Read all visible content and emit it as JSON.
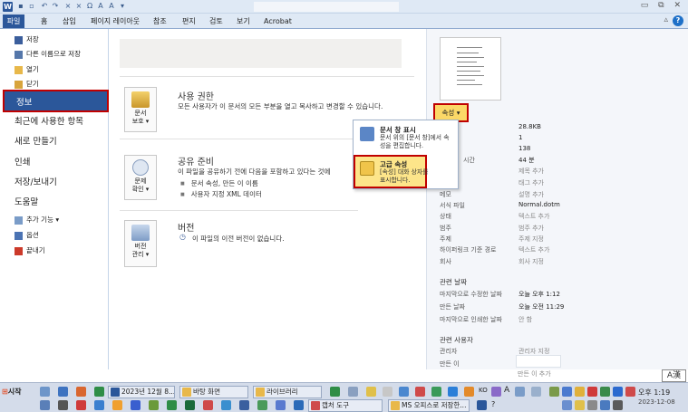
{
  "tabs": {
    "file": "파일",
    "home": "홈",
    "insert": "삽입",
    "page_layout": "페이지 레이아웃",
    "references": "참조",
    "mailings": "편지",
    "review": "검토",
    "view": "보기",
    "acrobat": "Acrobat"
  },
  "nav": {
    "save": "저장",
    "save_as": "다른 이름으로 저장",
    "open": "열기",
    "close": "닫기",
    "info": "정보",
    "recent": "최근에 사용한 항목",
    "new": "새로 만들기",
    "print": "인쇄",
    "save_send": "저장/보내기",
    "help": "도움말",
    "addins": "추가 기능 ▾",
    "options": "옵션",
    "exit": "끝내기"
  },
  "permissions": {
    "button_line1": "문서",
    "button_line2": "보호 ▾",
    "title": "사용 권한",
    "desc": "모든 사용자가 이 문서의 모든 부분을 열고 복사하고 변경할 수 있습니다."
  },
  "share": {
    "button_line1": "문제",
    "button_line2": "확인 ▾",
    "title": "공유 준비",
    "desc": "이 파일을 공유하기 전에 다음을 포함하고 있다는 것에",
    "bullet1": "문서 속성, 만든 이 이름",
    "bullet2": "사용자 지정 XML 데이터"
  },
  "versions": {
    "button_line1": "버전",
    "button_line2": "관리 ▾",
    "title": "버전",
    "desc": "이 파일의 이전 버전이 없습니다."
  },
  "properties_button": "속성 ▾",
  "dropdown": {
    "item1_title": "문서 창 표시",
    "item1_desc": "문서 위의 [문서 창]에서 속성을 편집합니다.",
    "item2_title": "고급 속성",
    "item2_desc": "[속성] 대화 상자를 표시합니다."
  },
  "properties": {
    "size_value": "28.8KB",
    "pages_value": "1",
    "words_value": "138",
    "time_label": "시간",
    "time_value": "44 분",
    "title_value": "제목 추가",
    "tags_value": "태그 추가",
    "comments_label": "메모",
    "comments_value": "설명 추가",
    "template_label": "서식 파일",
    "template_value": "Normal.dotm",
    "status_label": "상태",
    "status_value": "텍스트 추가",
    "category_label": "범주",
    "category_value": "범주 추가",
    "subject_label": "주제",
    "subject_value": "주제 지정",
    "hyperlink_label": "하이퍼링크 기준 경로",
    "hyperlink_value": "텍스트 추가",
    "company_label": "회사",
    "company_value": "회사 지정"
  },
  "related_dates": {
    "heading": "관련 날짜",
    "modified_label": "마지막으로 수정한 날짜",
    "modified_value": "오늘 오후 1:12",
    "created_label": "만든 날짜",
    "created_value": "오늘 오전 11:29",
    "printed_label": "마지막으로 인쇄한 날짜",
    "printed_value": "안 함"
  },
  "related_people": {
    "heading": "관련 사용자",
    "manager_label": "관리자",
    "manager_value": "관리자 지정",
    "author_label": "만든 이",
    "add_author": "만든 이 추가"
  },
  "ime": "A漢",
  "taskbar": {
    "start": "시작",
    "task_word": "2023년 12월 8...",
    "task_desktop": "바탕 화면",
    "task_library": "라이브러리",
    "task_capture": "캡처 도구",
    "task_office": "MS 오피스로 저장한...",
    "lang": "KO",
    "time": "오후 1:19",
    "date": "2023-12-08"
  }
}
